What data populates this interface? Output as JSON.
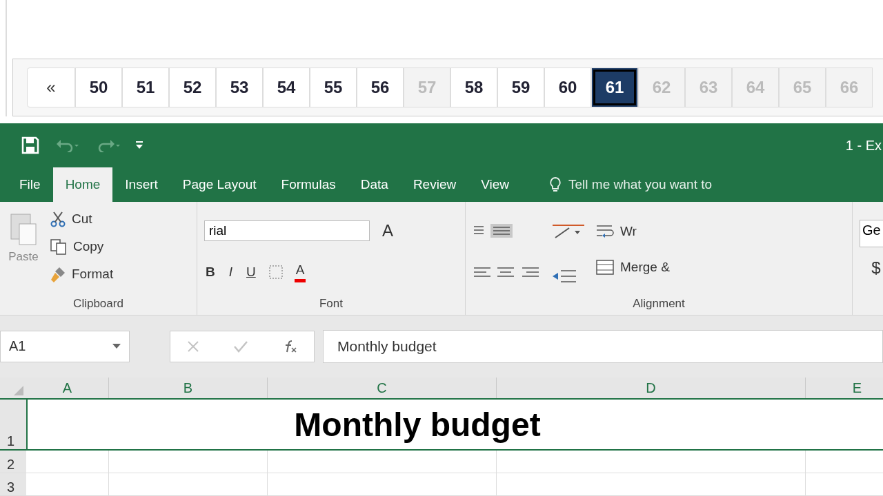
{
  "pagination": {
    "first": "«",
    "pages": [
      {
        "label": "50",
        "selected": false,
        "disabled": false
      },
      {
        "label": "51",
        "selected": false,
        "disabled": false
      },
      {
        "label": "52",
        "selected": false,
        "disabled": false
      },
      {
        "label": "53",
        "selected": false,
        "disabled": false
      },
      {
        "label": "54",
        "selected": false,
        "disabled": false
      },
      {
        "label": "55",
        "selected": false,
        "disabled": false
      },
      {
        "label": "56",
        "selected": false,
        "disabled": false
      },
      {
        "label": "57",
        "selected": false,
        "disabled": true
      },
      {
        "label": "58",
        "selected": false,
        "disabled": false
      },
      {
        "label": "59",
        "selected": false,
        "disabled": false
      },
      {
        "label": "60",
        "selected": false,
        "disabled": false
      },
      {
        "label": "61",
        "selected": true,
        "disabled": false
      },
      {
        "label": "62",
        "selected": false,
        "disabled": true
      },
      {
        "label": "63",
        "selected": false,
        "disabled": true
      },
      {
        "label": "64",
        "selected": false,
        "disabled": true
      },
      {
        "label": "65",
        "selected": false,
        "disabled": true
      },
      {
        "label": "66",
        "selected": false,
        "disabled": true
      }
    ]
  },
  "window": {
    "title": "1 - Ex"
  },
  "tabs": [
    {
      "label": "File",
      "selected": false
    },
    {
      "label": "Home",
      "selected": true
    },
    {
      "label": "Insert",
      "selected": false
    },
    {
      "label": "Page Layout",
      "selected": false
    },
    {
      "label": "Formulas",
      "selected": false
    },
    {
      "label": "Data",
      "selected": false
    },
    {
      "label": "Review",
      "selected": false
    },
    {
      "label": "View",
      "selected": false
    }
  ],
  "tell_me": "Tell me what you want to",
  "ribbon": {
    "clipboard": {
      "paste": "Paste",
      "cut": "Cut",
      "copy": "Copy",
      "format": "Format",
      "label": "Clipboard"
    },
    "font": {
      "name": "rial",
      "bold": "B",
      "italic": "I",
      "underline": "U",
      "grow": "A",
      "font_color": "A",
      "label": "Font"
    },
    "alignment": {
      "wrap": "Wr",
      "merge": "Merge &",
      "label": "Alignment"
    },
    "number": {
      "format": "Ge",
      "currency": "$"
    }
  },
  "formula_bar": {
    "name_box": "A1",
    "formula": "Monthly budget"
  },
  "sheet": {
    "columns": [
      "A",
      "B",
      "C",
      "D",
      "E"
    ],
    "rows": [
      "1",
      "2",
      "3"
    ],
    "title": "Monthly budget"
  }
}
